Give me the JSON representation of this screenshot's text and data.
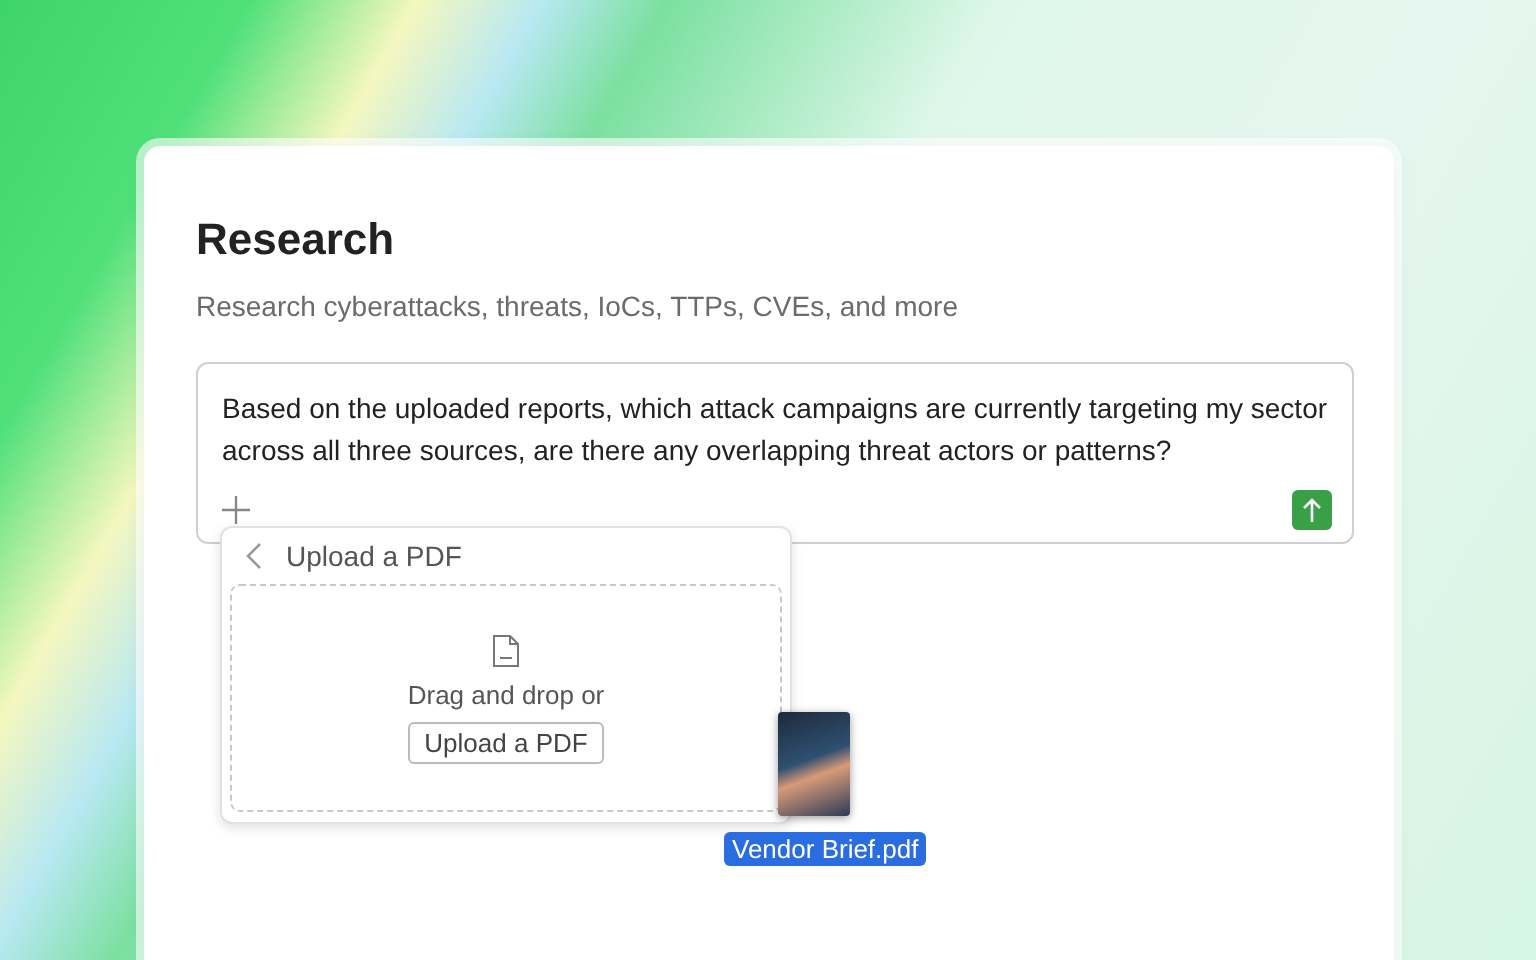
{
  "page": {
    "title": "Research",
    "subtitle": "Research cyberattacks, threats, IoCs, TTPs, CVEs, and more"
  },
  "prompt": {
    "value": "Based on the uploaded reports, which attack campaigns are currently targeting my sector across all three sources, are there any overlapping threat actors or patterns?"
  },
  "upload_menu": {
    "title": "Upload a PDF",
    "drop_text": "Drag and drop or",
    "button": "Upload a PDF"
  },
  "dragged_file": {
    "name": "Vendor Brief.pdf"
  }
}
